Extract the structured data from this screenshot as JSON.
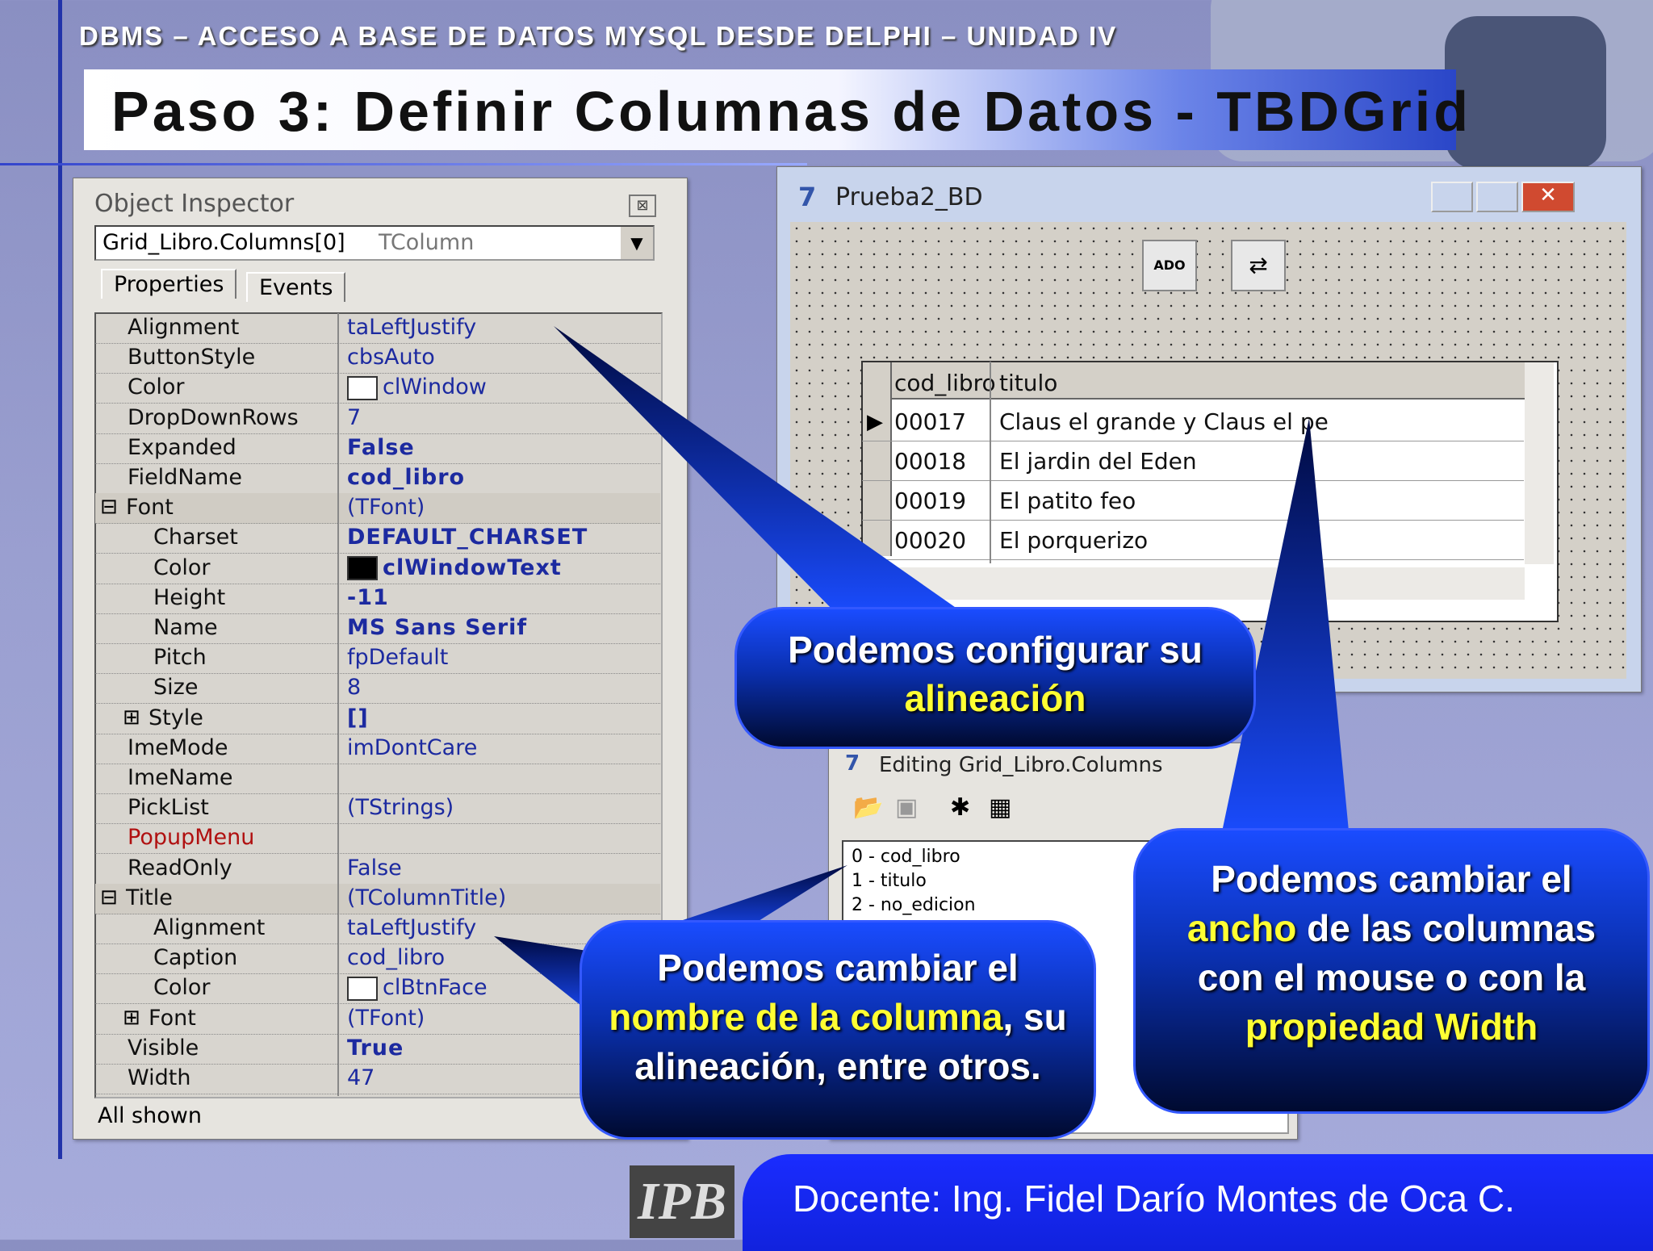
{
  "header": {
    "course": "DBMS – ACCESO A BASE DE DATOS MYSQL DESDE DELPHI – UNIDAD IV",
    "title": "Paso 3: Definir Columnas de Datos - TBDGrid"
  },
  "object_inspector": {
    "title": "Object Inspector",
    "selected_object": "Grid_Libro.Columns[0]",
    "selected_type": "TColumn",
    "tabs": [
      "Properties",
      "Events"
    ],
    "footer": "All shown",
    "properties": [
      {
        "name": "Alignment",
        "value": "taLeftJustify"
      },
      {
        "name": "ButtonStyle",
        "value": "cbsAuto"
      },
      {
        "name": "Color",
        "value": "clWindow"
      },
      {
        "name": "DropDownRows",
        "value": "7"
      },
      {
        "name": "Expanded",
        "value": "False"
      },
      {
        "name": "FieldName",
        "value": "cod_libro"
      },
      {
        "name": "Font",
        "value": "(TFont)"
      },
      {
        "name": "Charset",
        "value": "DEFAULT_CHARSET"
      },
      {
        "name": "Color",
        "value": "clWindowText"
      },
      {
        "name": "Height",
        "value": "-11"
      },
      {
        "name": "Name",
        "value": "MS Sans Serif"
      },
      {
        "name": "Pitch",
        "value": "fpDefault"
      },
      {
        "name": "Size",
        "value": "8"
      },
      {
        "name": "Style",
        "value": "[]"
      },
      {
        "name": "ImeMode",
        "value": "imDontCare"
      },
      {
        "name": "ImeName",
        "value": ""
      },
      {
        "name": "PickList",
        "value": "(TStrings)"
      },
      {
        "name": "PopupMenu",
        "value": ""
      },
      {
        "name": "ReadOnly",
        "value": "False"
      },
      {
        "name": "Title",
        "value": "(TColumnTitle)"
      },
      {
        "name": "Alignment",
        "value": "taLeftJustify"
      },
      {
        "name": "Caption",
        "value": "cod_libro"
      },
      {
        "name": "Color",
        "value": "clBtnFace"
      },
      {
        "name": "Font",
        "value": "(TFont)"
      },
      {
        "name": "Visible",
        "value": "True"
      },
      {
        "name": "Width",
        "value": "47"
      }
    ]
  },
  "form": {
    "title": "Prueba2_BD",
    "grid": {
      "columns": [
        "cod_libro",
        "titulo"
      ],
      "rows": [
        [
          "00017",
          "Claus el grande y Claus el pe"
        ],
        [
          "00018",
          "El jardin del Eden"
        ],
        [
          "00019",
          "El patito feo"
        ],
        [
          "00020",
          "El porquerizo"
        ]
      ]
    }
  },
  "columns_editor": {
    "title": "Editing Grid_Libro.Columns",
    "items": [
      "0 - cod_libro",
      "1 - titulo",
      "2 - no_edicion"
    ]
  },
  "callouts": {
    "align_pre": "Podemos configurar su ",
    "align_hl": "alineación",
    "name_pre": "Podemos cambiar el ",
    "name_hl": "nombre de la columna",
    "name_post": ", su alineación, entre otros.",
    "width_pre": "Podemos cambiar el ",
    "width_hl1": "ancho",
    "width_mid": " de las columnas con el mouse o con la ",
    "width_hl2": "propiedad Width"
  },
  "footer": {
    "logo": "IPB",
    "docente": "Docente: Ing. Fidel Darío Montes de Oca C."
  },
  "colors": {
    "callout_gradient_top": "#1a4cff",
    "callout_gradient_bottom": "#000a30",
    "highlight": "#ffff33",
    "property_value": "#1c2aa0"
  }
}
